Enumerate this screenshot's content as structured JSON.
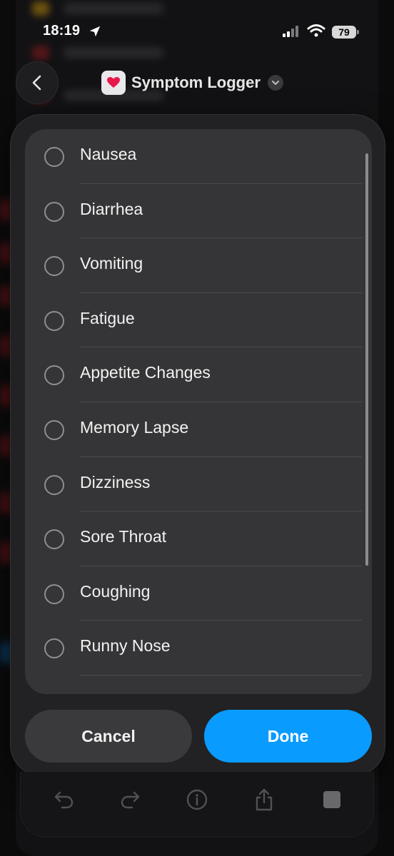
{
  "status_bar": {
    "time": "18:19",
    "battery": "79",
    "icons": [
      "location-arrow-icon",
      "signal-icon",
      "wifi-icon",
      "battery-icon"
    ]
  },
  "nav": {
    "title": "Symptom Logger",
    "back_icon": "chevron-left-icon",
    "app_icon": "heart-icon",
    "title_menu_icon": "chevron-down-icon"
  },
  "symptoms": {
    "items": [
      {
        "label": "Nausea",
        "selected": false
      },
      {
        "label": "Diarrhea",
        "selected": false
      },
      {
        "label": "Vomiting",
        "selected": false
      },
      {
        "label": "Fatigue",
        "selected": false
      },
      {
        "label": "Appetite Changes",
        "selected": false
      },
      {
        "label": "Memory Lapse",
        "selected": false
      },
      {
        "label": "Dizziness",
        "selected": false
      },
      {
        "label": "Sore Throat",
        "selected": false
      },
      {
        "label": "Coughing",
        "selected": false
      },
      {
        "label": "Runny Nose",
        "selected": false
      }
    ]
  },
  "actions": {
    "cancel_label": "Cancel",
    "done_label": "Done"
  },
  "toolbar": {
    "icons": [
      "undo-icon",
      "redo-icon",
      "info-icon",
      "share-icon",
      "stop-icon"
    ]
  },
  "colors": {
    "accent": "#0a9bff",
    "modal_bg": "#222224",
    "list_bg": "#353537",
    "radio_border": "#8e8e93"
  }
}
